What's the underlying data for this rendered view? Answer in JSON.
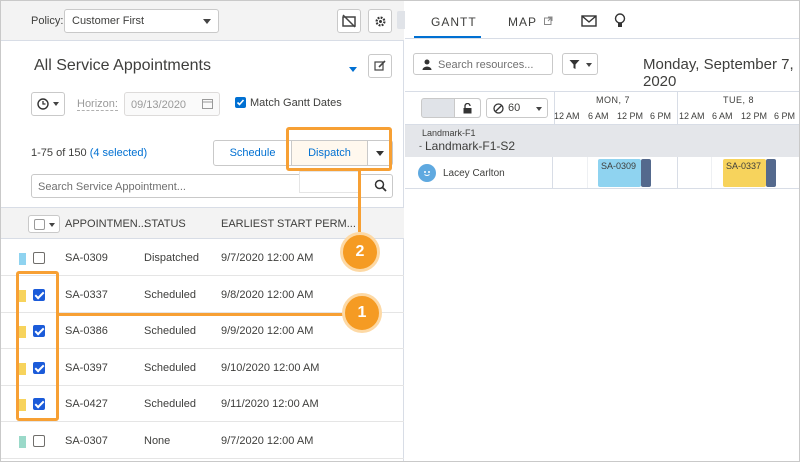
{
  "policy": {
    "label": "Policy:",
    "value": "Customer First"
  },
  "list": {
    "title": "All Service Appointments",
    "horizon_label": "Horizon:",
    "horizon_value": "09/13/2020",
    "match_label": "Match Gantt Dates",
    "count_text": "1-75 of 150",
    "selected_text": "(4 selected)",
    "schedule_label": "Schedule",
    "dispatch_label": "Dispatch",
    "search_placeholder": "Search Service Appointment...",
    "columns": [
      "APPOINTMEN...",
      "STATUS",
      "EARLIEST START PERM..."
    ],
    "rows": [
      {
        "id": "SA-0309",
        "status": "Dispatched",
        "start": "9/7/2020 12:00 AM",
        "checked": false,
        "color": "#8fd3f0"
      },
      {
        "id": "SA-0337",
        "status": "Scheduled",
        "start": "9/8/2020 12:00 AM",
        "checked": true,
        "color": "#f7d35c"
      },
      {
        "id": "SA-0386",
        "status": "Scheduled",
        "start": "9/9/2020 12:00 AM",
        "checked": true,
        "color": "#f7d35c"
      },
      {
        "id": "SA-0397",
        "status": "Scheduled",
        "start": "9/10/2020 12:00 AM",
        "checked": true,
        "color": "#f7d35c"
      },
      {
        "id": "SA-0427",
        "status": "Scheduled",
        "start": "9/11/2020 12:00 AM",
        "checked": true,
        "color": "#f7d35c"
      },
      {
        "id": "SA-0307",
        "status": "None",
        "start": "9/7/2020 12:00 AM",
        "checked": false,
        "color": "#9ad9c9"
      }
    ]
  },
  "gantt": {
    "tab_gantt": "GANTT",
    "tab_map": "MAP",
    "search_placeholder": "Search resources...",
    "date_title": "Monday, September 7, 2020",
    "gap_value": "60",
    "days": [
      "MON, 7",
      "TUE, 8"
    ],
    "hours": [
      "12 AM",
      "6 AM",
      "12 PM",
      "6 PM",
      "12 AM",
      "6 AM",
      "12 PM",
      "6 PM"
    ],
    "group_small": "Landmark-F1",
    "group_big": "Landmark-F1-S2",
    "resource_name": "Lacey Carlton",
    "blocks": [
      {
        "id": "SA-0309",
        "color": "#8fd3f0"
      },
      {
        "id": "SA-0337",
        "color": "#f7d35c"
      }
    ]
  },
  "callouts": {
    "one": "1",
    "two": "2"
  },
  "colors": {
    "accent": "#0070d2",
    "callout": "#f7a034",
    "checkbox": "#1b5bd9"
  }
}
